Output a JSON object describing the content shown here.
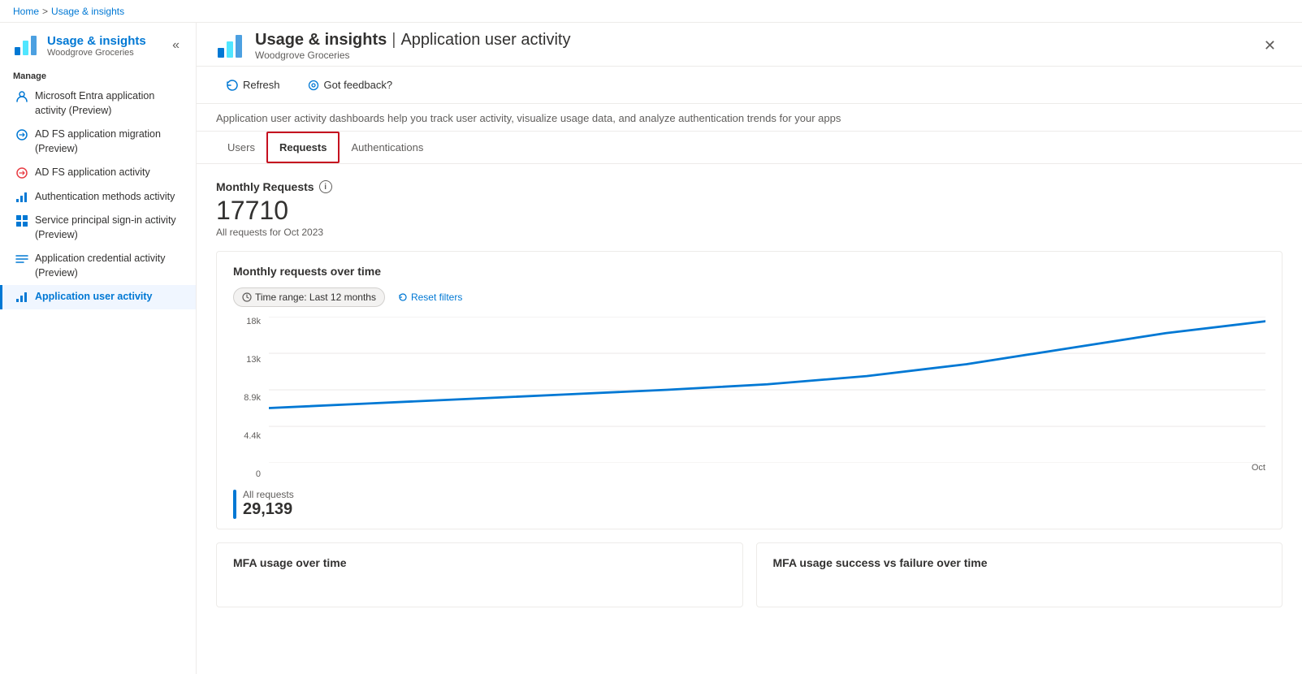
{
  "breadcrumb": {
    "home": "Home",
    "separator": ">",
    "current": "Usage & insights"
  },
  "page_header": {
    "title": "Usage & insights",
    "separator": "|",
    "subtitle": "Application user activity",
    "org": "Woodgrove Groceries",
    "close_label": "✕"
  },
  "toolbar": {
    "refresh_label": "Refresh",
    "feedback_label": "Got feedback?"
  },
  "description": "Application user activity dashboards help you track user activity, visualize usage data, and analyze authentication trends for your apps",
  "tabs": {
    "items": [
      {
        "label": "Users",
        "active": false
      },
      {
        "label": "Requests",
        "active": true
      },
      {
        "label": "Authentications",
        "active": false
      }
    ]
  },
  "monthly_requests": {
    "label": "Monthly Requests",
    "number": "17710",
    "sub": "All requests for Oct 2023"
  },
  "chart": {
    "title": "Monthly requests over time",
    "time_range_label": "Time range: Last 12 months",
    "reset_filters_label": "Reset filters",
    "y_labels": [
      "18k",
      "13k",
      "8.9k",
      "4.4k",
      "0"
    ],
    "x_label": "Oct",
    "all_requests_label": "All requests",
    "all_requests_number": "29,139"
  },
  "bottom_panels": [
    {
      "title": "MFA usage over time"
    },
    {
      "title": "MFA usage success vs failure over time"
    }
  ],
  "sidebar": {
    "manage_label": "Manage",
    "collapse_icon": "«",
    "app_title": "Usage & insights",
    "app_subtitle": "Woodgrove Groceries",
    "items": [
      {
        "label": "Microsoft Entra application activity (Preview)",
        "icon": "person"
      },
      {
        "label": "AD FS application migration (Preview)",
        "icon": "adfs-migrate"
      },
      {
        "label": "AD FS application activity",
        "icon": "adfs-activity"
      },
      {
        "label": "Authentication methods activity",
        "icon": "chart-bar"
      },
      {
        "label": "Service principal sign-in activity (Preview)",
        "icon": "grid"
      },
      {
        "label": "Application credential activity (Preview)",
        "icon": "lines"
      },
      {
        "label": "Application user activity",
        "icon": "chart-bar",
        "active": true
      }
    ]
  }
}
